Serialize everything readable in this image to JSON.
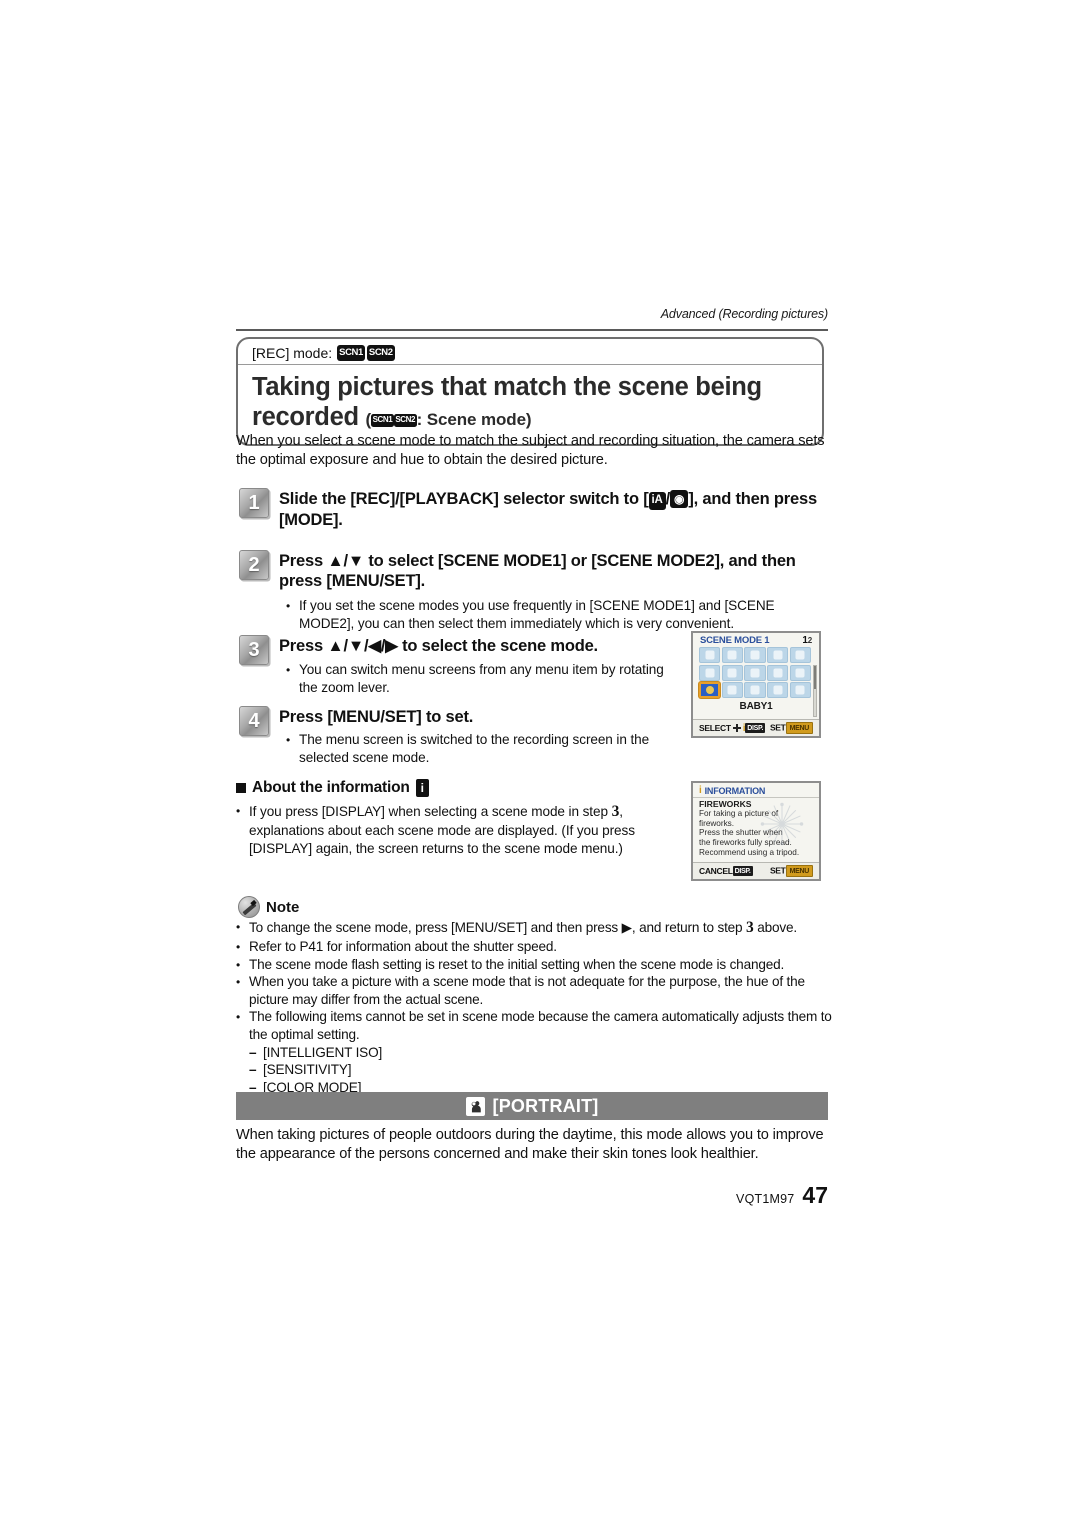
{
  "running_head": "Advanced (Recording pictures)",
  "title_box": {
    "rec_mode_label": "[REC] mode:",
    "rec_mode_icons": [
      "SCN1",
      "SCN2"
    ],
    "title_line1": "Taking pictures that match the scene being",
    "title_line2": "recorded",
    "subtitle_icons": [
      "SCN1",
      "SCN2"
    ],
    "subtitle_text": ": Scene mode)"
  },
  "intro": "When you select a scene mode to match the subject and recording situation, the camera sets the optimal exposure and hue to obtain the desired picture.",
  "steps": [
    {
      "number": "1",
      "text_before": "Slide the [REC]/[PLAYBACK] selector switch to [",
      "icon_ia": "iA",
      "separator": "/",
      "icon_cam": "camera-icon",
      "text_after": "], and then press [MODE]."
    },
    {
      "number": "2",
      "text": "Press ▲/▼ to select [SCENE MODE1] or [SCENE MODE2], and then press [MENU/SET]."
    },
    {
      "number": "3",
      "text": "Press ▲/▼/◀/▶ to select the scene mode."
    },
    {
      "number": "4",
      "text": "Press [MENU/SET] to set."
    }
  ],
  "bullets_step2": [
    "If you set the scene modes you use frequently in [SCENE MODE1] and [SCENE MODE2], you can then select them immediately which is very convenient."
  ],
  "bullets_step3": [
    "You can switch menu screens from any menu item by rotating the zoom lever."
  ],
  "bullets_step4": [
    "The menu screen is switched to the recording screen in the selected scene mode."
  ],
  "about_information": {
    "heading": "About the information",
    "heading_icon": "i",
    "bullet_part1": "If you press [DISPLAY] when selecting a scene mode in step ",
    "bullet_step_ref": "3",
    "bullet_part2": ", explanations about each scene mode are displayed. (If you press [DISPLAY] again, the screen returns to the scene mode menu.)"
  },
  "lcd_scene_menu": {
    "title": "SCENE MODE 1",
    "page_current": "1",
    "page_total": "2",
    "selected_name": "BABY1",
    "grid_rows": 3,
    "grid_cols": 5,
    "selected_index": 10,
    "footer_select": "SELECT",
    "footer_disp_chip": "DISP.",
    "footer_set": "SET",
    "footer_set_chip": "MENU"
  },
  "lcd_information": {
    "title": "INFORMATION",
    "mode_name": "FIREWORKS",
    "lines": [
      "For taking a picture of",
      "fireworks.",
      "Press the shutter when",
      "the fireworks fully spread.",
      "Recommend using a tripod."
    ],
    "footer_cancel": "CANCEL",
    "footer_cancel_chip": "DISP.",
    "footer_set": "SET",
    "footer_set_chip": "MENU"
  },
  "note": {
    "heading": "Note",
    "items": [
      {
        "part1": "To change the scene mode, press [MENU/SET] and then press ▶, and return to step ",
        "step_ref": "3",
        "part2": " above."
      },
      {
        "part1": "Refer to P41 for information about the shutter speed."
      },
      {
        "part1": "The scene mode flash setting is reset to the initial setting when the scene mode is changed."
      },
      {
        "part1": "When you take a picture with a scene mode that is not adequate for the purpose, the hue of the picture may differ from the actual scene."
      },
      {
        "part1": "The following items cannot be set in scene mode because the camera automatically adjusts them to the optimal setting."
      }
    ],
    "sub_items": [
      "[INTELLIGENT ISO]",
      "[SENSITIVITY]",
      "[COLOR MODE]"
    ]
  },
  "portrait_section": {
    "bar_label": "[PORTRAIT]",
    "bar_icon": "portrait-icon",
    "description": "When taking pictures of people outdoors during the daytime, this mode allows you to improve the appearance of the persons concerned and make their skin tones look healthier."
  },
  "footer": {
    "code": "VQT1M97",
    "page_number": "47"
  },
  "colors": {
    "rule": "#5a5a5a",
    "title_box_border": "#6f6f6f",
    "mode_bar": "#7f7f7f",
    "lcd_blue": "#2a4e9b",
    "lcd_gold": "#d19b1e",
    "selection": "#2a5fc4"
  }
}
